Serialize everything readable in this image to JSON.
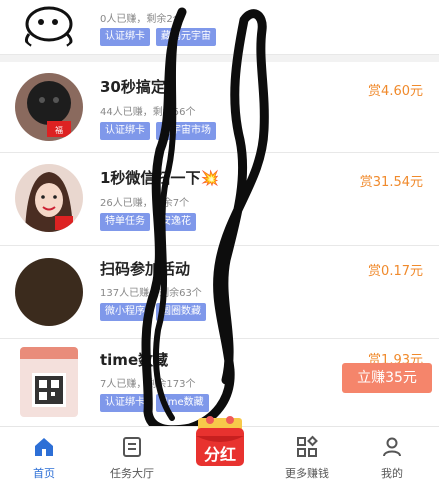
{
  "tasks": [
    {
      "title": "",
      "stats": "0人已赚，剩余2个",
      "reward": "",
      "tags": [
        "认证绑卡",
        "藏鹏元宇宙"
      ]
    },
    {
      "title": "30秒搞定",
      "stats": "44人已赚，剩余56个",
      "reward": "赏4.60元",
      "tags": [
        "认证绑卡",
        "元宇宙市场"
      ]
    },
    {
      "title": "1秒微信扫一下💥",
      "stats": "26人已赚，剩余7个",
      "reward": "赏31.54元",
      "tags": [
        "特单任务",
        "安逸花"
      ]
    },
    {
      "title": "扫码参加活动",
      "stats": "137人已赚，剩余63个",
      "reward": "赏0.17元",
      "tags": [
        "微小程序",
        "圆圈数藏"
      ]
    },
    {
      "title": "time数藏",
      "stats": "7人已赚，剩余173个",
      "reward": "赏1.93元",
      "tags": [
        "认证绑卡",
        "time数藏"
      ]
    }
  ],
  "cta": {
    "label": "立赚35元"
  },
  "tabbar": {
    "home": "首页",
    "tasks": "任务大厅",
    "fenhong": "分红",
    "more": "更多赚钱",
    "mine": "我的"
  },
  "colors": {
    "tag": "#7f98ea",
    "reward": "#f08a2c",
    "active_tab": "#2d6fd6",
    "cta": "#f5856b"
  }
}
